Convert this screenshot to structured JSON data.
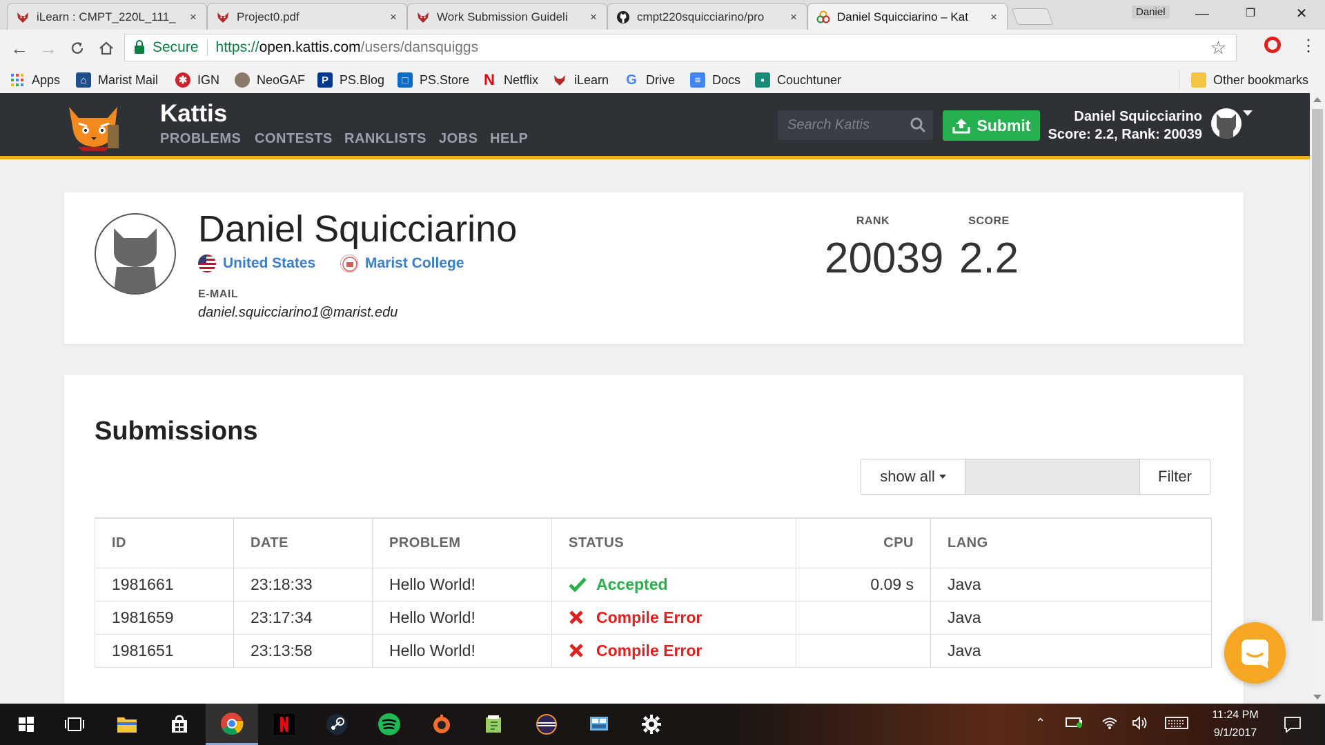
{
  "browser": {
    "tabs": [
      {
        "title": "iLearn : CMPT_220L_111_",
        "favicon": "marist-fox-icon"
      },
      {
        "title": "Project0.pdf",
        "favicon": "marist-fox-icon"
      },
      {
        "title": "Work Submission Guideli",
        "favicon": "marist-fox-icon"
      },
      {
        "title": "cmpt220squicciarino/pro",
        "favicon": "github-icon"
      },
      {
        "title": "Daniel Squicciarino – Kat",
        "favicon": "kattis-icon"
      }
    ],
    "tab_close_glyph": "×",
    "profile_name": "Daniel",
    "address": {
      "secure_label": "Secure",
      "scheme": "https://",
      "host": "open.kattis.com",
      "path": "/users/dansquiggs"
    },
    "bookmarks": [
      {
        "label": "Apps",
        "icon": "apps-grid-icon"
      },
      {
        "label": "Marist Mail",
        "icon": "home-mail-icon"
      },
      {
        "label": "IGN",
        "icon": "ign-icon"
      },
      {
        "label": "NeoGAF",
        "icon": "neogaf-icon"
      },
      {
        "label": "PS.Blog",
        "icon": "playstation-icon"
      },
      {
        "label": "PS.Store",
        "icon": "ps-store-icon"
      },
      {
        "label": "Netflix",
        "icon": "netflix-icon"
      },
      {
        "label": "iLearn",
        "icon": "marist-fox-icon"
      },
      {
        "label": "Drive",
        "icon": "google-icon"
      },
      {
        "label": "Docs",
        "icon": "docs-icon"
      },
      {
        "label": "Couchtuner",
        "icon": "couchtuner-icon"
      }
    ],
    "other_bookmarks": "Other bookmarks"
  },
  "kattis": {
    "brand": "Kattis",
    "nav": [
      "PROBLEMS",
      "CONTESTS",
      "RANKLISTS",
      "JOBS",
      "HELP"
    ],
    "search_placeholder": "Search Kattis",
    "submit_label": "Submit",
    "user_name": "Daniel Squicciarino",
    "user_score_line": "Score: 2.2, Rank: 20039",
    "accent_color": "#f5a623",
    "submit_color": "#27b04f"
  },
  "profile": {
    "name": "Daniel Squicciarino",
    "country": "United States",
    "school": "Marist College",
    "email_label": "E-MAIL",
    "email": "daniel.squicciarino1@marist.edu",
    "rank_label": "RANK",
    "rank": "20039",
    "score_label": "SCORE",
    "score": "2.2"
  },
  "submissions": {
    "title": "Submissions",
    "filter_select": "show all",
    "filter_value": "",
    "filter_button": "Filter",
    "columns": [
      "ID",
      "DATE",
      "PROBLEM",
      "STATUS",
      "CPU",
      "LANG"
    ],
    "rows": [
      {
        "id": "1981661",
        "date": "23:18:33",
        "problem": "Hello World!",
        "status": "Accepted",
        "status_kind": "ok",
        "cpu": "0.09 s",
        "lang": "Java"
      },
      {
        "id": "1981659",
        "date": "23:17:34",
        "problem": "Hello World!",
        "status": "Compile Error",
        "status_kind": "err",
        "cpu": "",
        "lang": "Java"
      },
      {
        "id": "1981651",
        "date": "23:13:58",
        "problem": "Hello World!",
        "status": "Compile Error",
        "status_kind": "err",
        "cpu": "",
        "lang": "Java"
      }
    ],
    "ok_color": "#28b04a",
    "err_color": "#e01f1f"
  },
  "taskbar": {
    "apps": [
      "windows-start-icon",
      "task-view-icon",
      "file-explorer-icon",
      "store-icon",
      "chrome-icon",
      "netflix-icon",
      "steam-icon",
      "spotify-icon",
      "origin-icon",
      "notepad-plus-icon",
      "eclipse-icon",
      "control-panel-icon",
      "settings-gear-icon"
    ],
    "time": "11:24 PM",
    "date": "9/1/2017"
  }
}
